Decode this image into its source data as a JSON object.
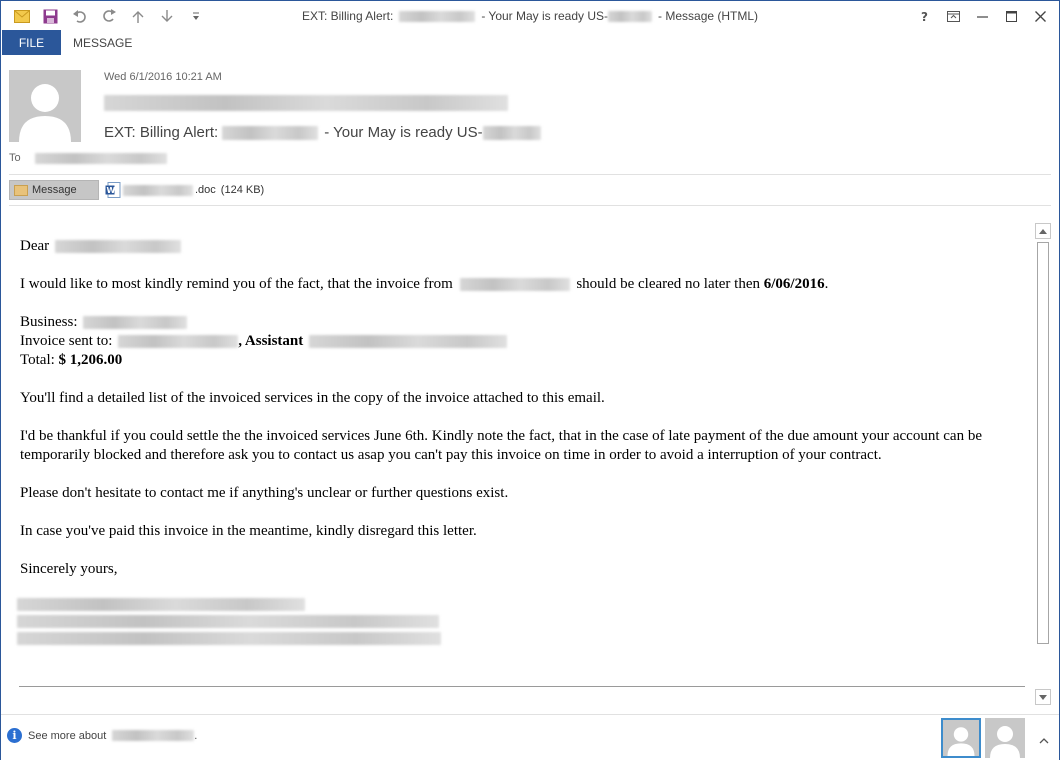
{
  "window": {
    "title_prefix": "EXT: Billing Alert:",
    "title_middle": "- Your May is ready US-",
    "title_suffix": "- Message (HTML)"
  },
  "ribbon": {
    "tabs": [
      {
        "label": "FILE",
        "active": true
      },
      {
        "label": "MESSAGE",
        "active": false
      }
    ]
  },
  "header": {
    "sent_date": "Wed 6/1/2016 10:21 AM",
    "subject_prefix": "EXT: Billing Alert:",
    "subject_middle": "- Your May is ready US-",
    "to_label": "To"
  },
  "attachments": {
    "message_label": "Message",
    "doc_name_suffix": ".doc",
    "doc_size": "(124 KB)"
  },
  "body": {
    "greeting": "Dear",
    "p1_before": "I would like to most kindly remind you of the fact, that the invoice from",
    "p1_after": "should be cleared no later then",
    "p1_date": "6/06/2016",
    "p1_end": ".",
    "business_label": "Business:",
    "invoice_sent_label": "Invoice sent to:",
    "assistant_label": ", Assistant",
    "total_label": "Total:",
    "total_value": "$ 1,206.00",
    "p3": "You'll find a detailed list of the invoiced services in the copy of the invoice attached to this email.",
    "p4": "I'd be thankful if you could settle the the invoiced services June 6th. Kindly note the fact, that in the case of late payment of the due amount your account can be temporarily blocked and therefore ask you to contact us asap you can't pay this invoice on time in order to avoid a interruption of your contract.",
    "p5": "Please don't hesitate to contact me if anything's unclear or further questions exist.",
    "p6": "In case you've paid this invoice in the meantime, kindly disregard this letter.",
    "closing": "Sincerely yours,"
  },
  "footer": {
    "see_more_label": "See more about",
    "see_more_end": "."
  },
  "colors": {
    "accent": "#2b579a",
    "info_blue": "#2b6fd1",
    "selected_border": "#3d8ccc"
  },
  "icons": {
    "quick_access": [
      "envelope-icon",
      "save-icon",
      "undo-icon",
      "redo-icon",
      "up-arrow-icon",
      "down-arrow-icon",
      "customize-icon"
    ],
    "window_controls": [
      "help-icon",
      "restore-ribbon-icon",
      "minimize-icon",
      "maximize-icon",
      "close-icon"
    ]
  }
}
